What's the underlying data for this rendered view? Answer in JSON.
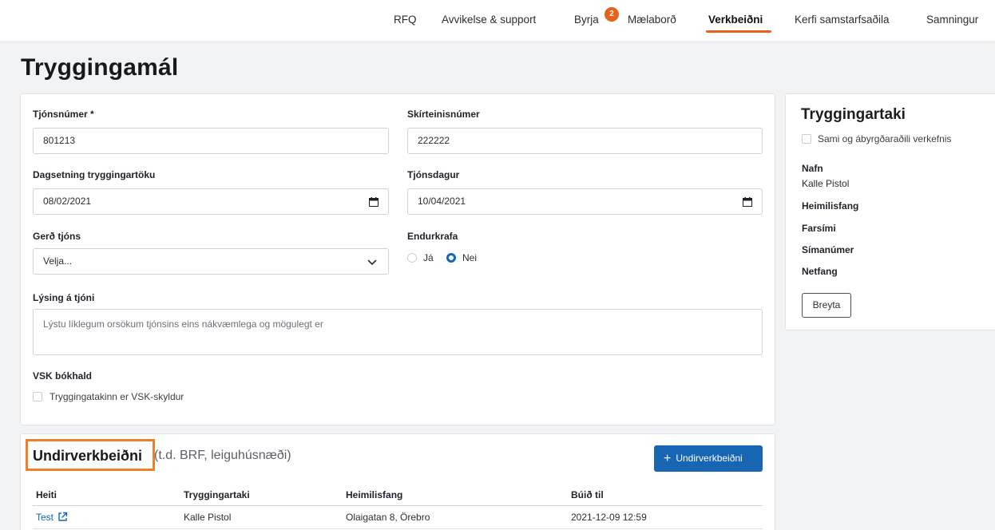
{
  "nav": {
    "items": [
      "RFQ",
      "Avvikelse & support",
      "Byrja",
      "Mælaborð",
      "Verkbeiðni",
      "Kerfi samstarfsaðila",
      "Samningur"
    ],
    "badge": "2",
    "active": "Verkbeiðni"
  },
  "page": {
    "title": "Tryggingamál"
  },
  "form": {
    "claim_number": {
      "label": "Tjónsnúmer *",
      "value": "801213"
    },
    "certificate_number": {
      "label": "Skírteinisnúmer",
      "value": "222222"
    },
    "insurance_date": {
      "label": "Dagsetning tryggingartöku",
      "value": "08/02/2021"
    },
    "claim_date": {
      "label": "Tjónsdagur",
      "value": "10/04/2021"
    },
    "claim_type": {
      "label": "Gerð tjóns",
      "value": "Velja..."
    },
    "recourse": {
      "label": "Endurkrafa",
      "options": [
        "Já",
        "Nei"
      ],
      "selected": "Nei"
    },
    "description": {
      "label": "Lýsing á tjóni",
      "placeholder": "Lýstu líklegum orsökum tjónsins eins nákvæmlega og mögulegt er"
    },
    "vat": {
      "label": "VSK bókhald",
      "checkbox_label": "Tryggingatakinn er VSK-skyldur",
      "checked": false
    }
  },
  "insured": {
    "title": "Tryggingartaki",
    "same_checkbox": "Sami og ábyrgðaraðili verkefnis",
    "name_label": "Nafn",
    "name_value": "Kalle Pistol",
    "address_label": "Heimilisfang",
    "mobile_label": "Farsími",
    "phone_label": "Símanúmer",
    "email_label": "Netfang",
    "edit_button": "Breyta"
  },
  "sub_requests": {
    "title": "Undirverkbeiðni",
    "hint": "(t.d. BRF, leiguhúsnæði)",
    "add_button": "Undirverkbeiðni",
    "columns": [
      "Heiti",
      "Tryggingartaki",
      "Heimilisfang",
      "Búið til"
    ],
    "rows": [
      {
        "name": "Test",
        "insured": "Kalle Pistol",
        "address": "Olaigatan 8, Örebro",
        "created": "2021-12-09 12:59"
      }
    ]
  },
  "colors": {
    "accent": "#e8611a",
    "primary": "#1666b3",
    "highlight": "#f07f2a"
  }
}
